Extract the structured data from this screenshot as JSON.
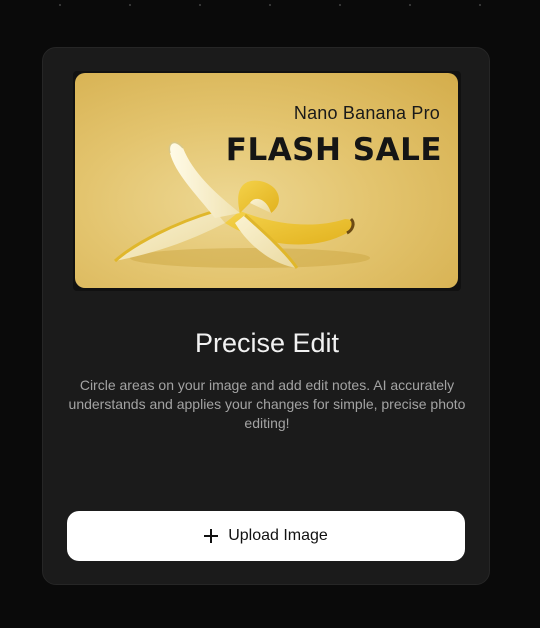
{
  "banner": {
    "brand": "Nano Banana Pro",
    "headline": "FLASH SALE",
    "image_subject": "peeled-banana-illustration"
  },
  "feature": {
    "title": "Precise Edit",
    "description": "Circle areas on your image and add edit notes. AI accurately understands and applies your changes for simple, precise photo editing!"
  },
  "upload": {
    "label": "Upload Image",
    "icon": "plus-icon"
  },
  "colors": {
    "background": "#0a0a0a",
    "card": "#1b1b1b",
    "button": "#ffffff",
    "banner": "#e3c46e"
  }
}
